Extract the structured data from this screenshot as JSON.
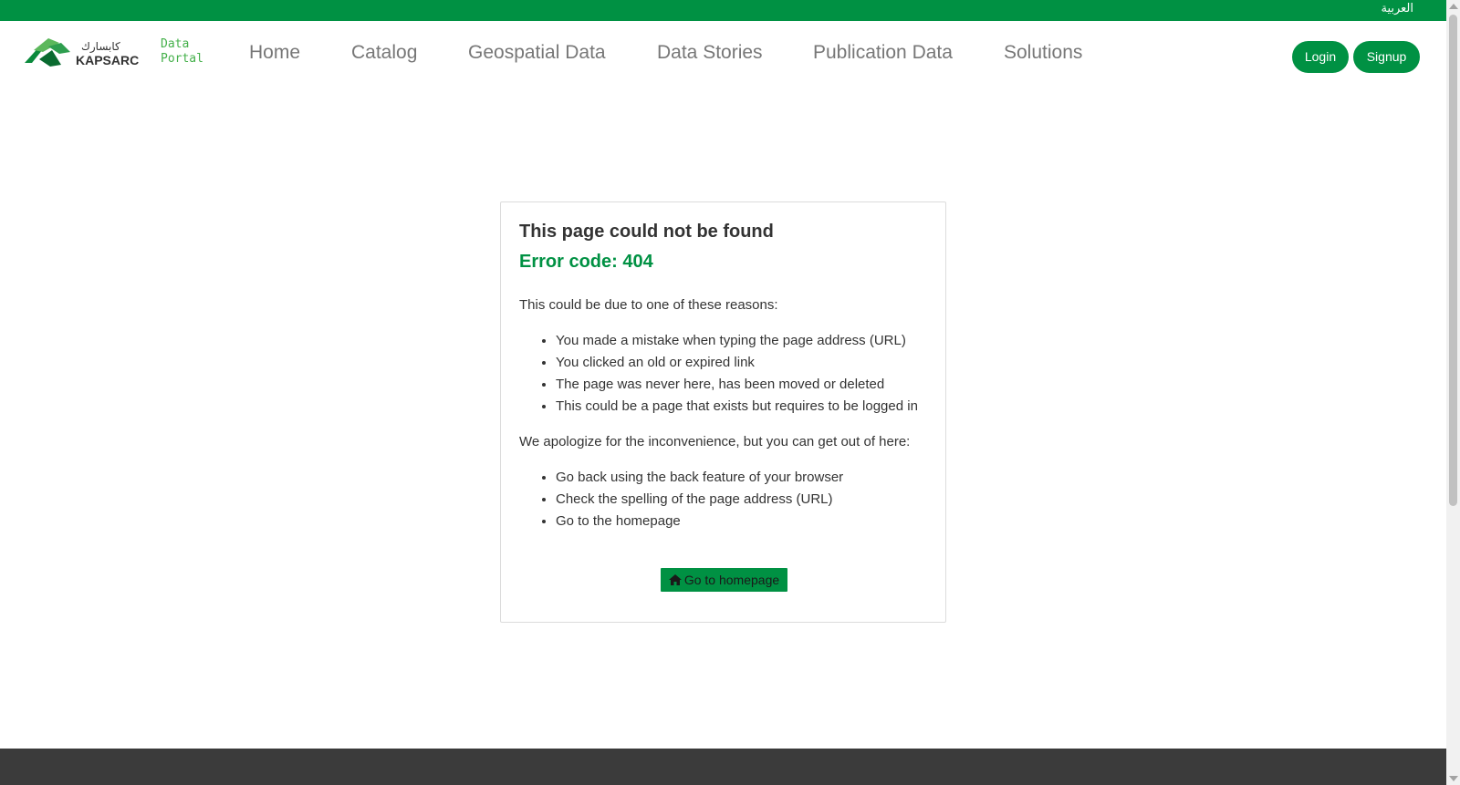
{
  "topbar": {
    "language_link": "العربية",
    "color": "#009143"
  },
  "logo": {
    "icon": "kapsarc-logo",
    "wordmark_arabic": "كابسارك",
    "wordmark_latin": "KAPSARC",
    "portal_line1": "Data",
    "portal_line2": "Portal"
  },
  "nav": {
    "items": [
      {
        "label": "Home"
      },
      {
        "label": "Catalog"
      },
      {
        "label": "Geospatial Data"
      },
      {
        "label": "Data Stories"
      },
      {
        "label": "Publication Data"
      },
      {
        "label": "Solutions"
      }
    ],
    "login_label": "Login",
    "signup_label": "Signup"
  },
  "error": {
    "title": "This page could not be found",
    "code_text": "Error code: 404",
    "reasons_intro": "This could be due to one of these reasons:",
    "reasons": [
      "You made a mistake when typing the page address (URL)",
      "You clicked an old or expired link",
      "The page was never here, has been moved or deleted",
      "This could be a page that exists but requires to be logged in"
    ],
    "options_intro": "We apologize for the inconvenience, but you can get out of here:",
    "options": [
      "Go back using the back feature of your browser",
      "Check the spelling of the page address (URL)",
      "Go to the homepage"
    ],
    "button_label": "Go to homepage",
    "button_icon": "home-icon"
  },
  "colors": {
    "accent": "#009143",
    "footer": "#3b3b3b"
  }
}
